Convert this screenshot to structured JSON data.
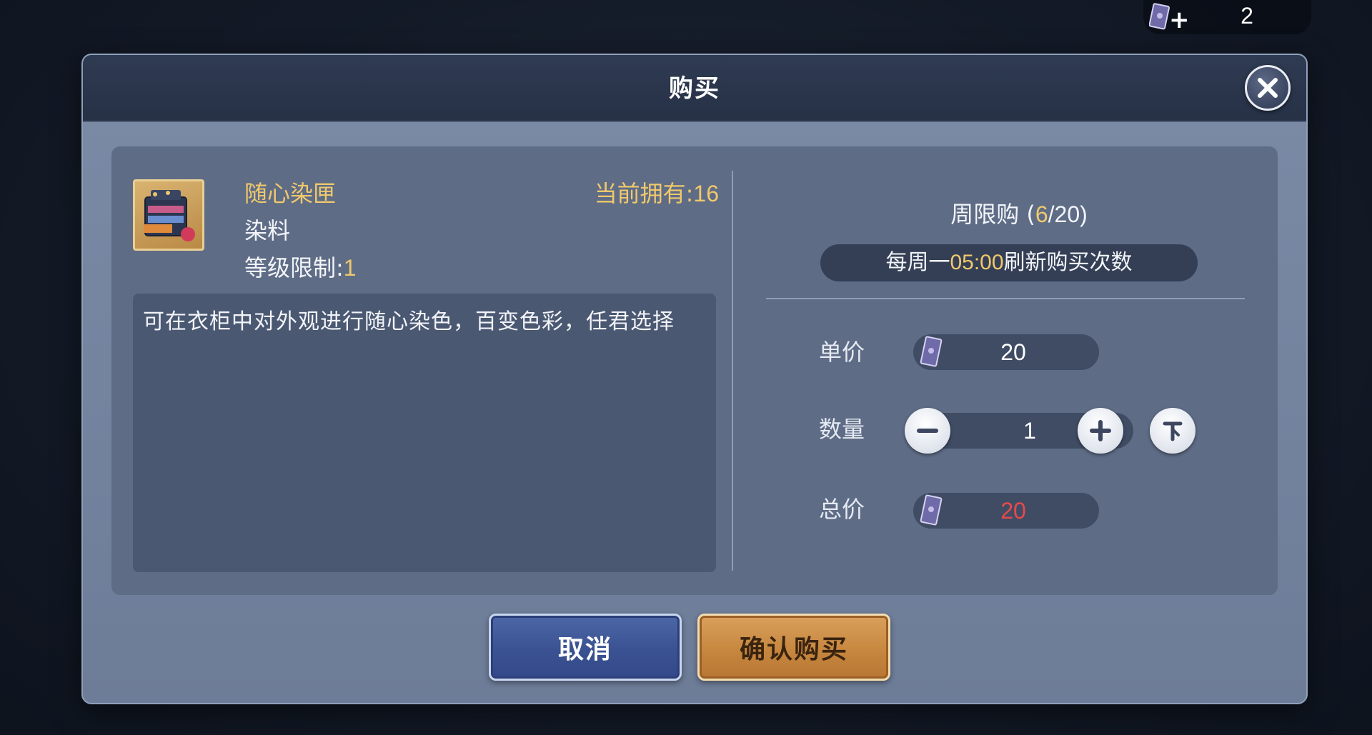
{
  "currency": {
    "plus": "+",
    "amount": "2",
    "icon": "coupon-icon"
  },
  "dialog": {
    "title": "购买",
    "close_icon": "close-icon"
  },
  "item": {
    "name": "随心染匣",
    "type": "染料",
    "level_label": "等级限制:",
    "level_value": "1",
    "owned_label": "当前拥有:",
    "owned_value": "16",
    "description": "可在衣柜中对外观进行随心染色，百变色彩，任君选择"
  },
  "limit": {
    "prefix": "周限购 (",
    "current": "6",
    "suffix": "/20)",
    "refresh_prefix": "每周一",
    "refresh_time": "05:00",
    "refresh_suffix": "刷新购买次数"
  },
  "purchase": {
    "unit_price_label": "单价",
    "unit_price": "20",
    "quantity_label": "数量",
    "quantity": "1",
    "total_label": "总价",
    "total": "20",
    "minus_icon": "minus-icon",
    "plus_icon": "plus-icon",
    "max_icon": "max-icon"
  },
  "buttons": {
    "cancel": "取消",
    "confirm": "确认购买"
  },
  "colors": {
    "gold": "#f0c86c",
    "total_red": "#e84a4a",
    "header": "#2f3b52"
  }
}
